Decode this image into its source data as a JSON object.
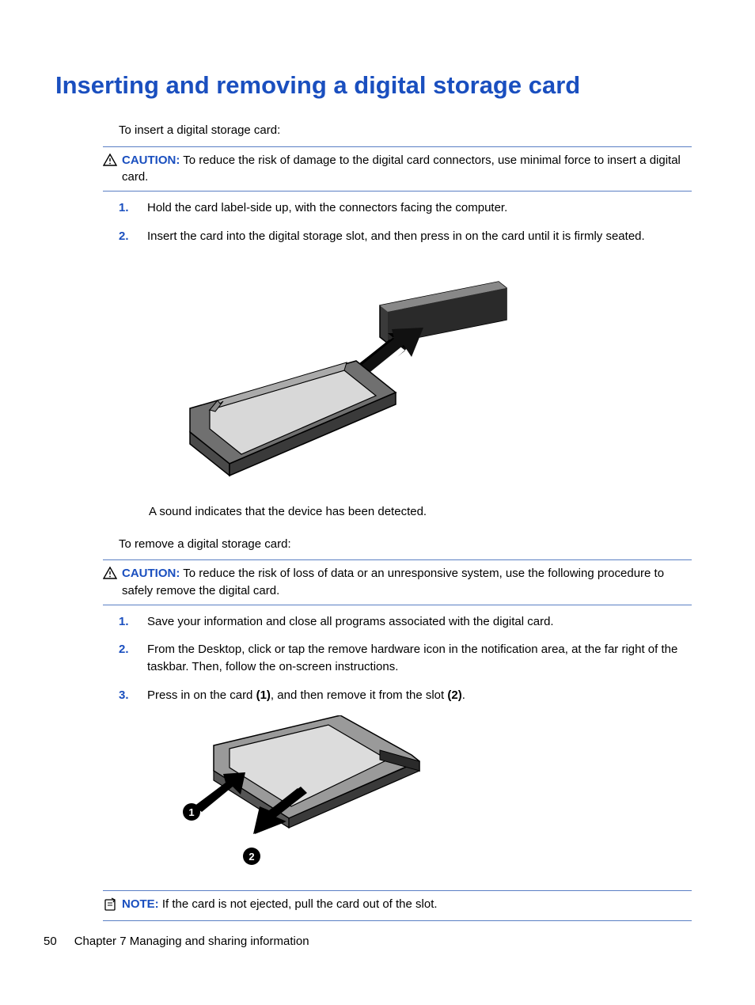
{
  "heading": "Inserting and removing a digital storage card",
  "intro_insert": "To insert a digital storage card:",
  "caution1": {
    "label": "CAUTION:",
    "text": "To reduce the risk of damage to the digital card connectors, use minimal force to insert a digital card."
  },
  "insert_steps": [
    {
      "num": "1.",
      "text": "Hold the card label-side up, with the connectors facing the computer."
    },
    {
      "num": "2.",
      "text": "Insert the card into the digital storage slot, and then press in on the card until it is firmly seated."
    }
  ],
  "sound_note": "A sound indicates that the device has been detected.",
  "intro_remove": "To remove a digital storage card:",
  "caution2": {
    "label": "CAUTION:",
    "text": "To reduce the risk of loss of data or an unresponsive system, use the following procedure to safely remove the digital card."
  },
  "remove_steps": [
    {
      "num": "1.",
      "text": "Save your information and close all programs associated with the digital card."
    },
    {
      "num": "2.",
      "text": "From the Desktop, click or tap the remove hardware icon in the notification area, at the far right of the taskbar. Then, follow the on-screen instructions."
    }
  ],
  "remove_step3": {
    "num": "3.",
    "pre": "Press in on the card ",
    "b1": "(1)",
    "mid": ", and then remove it from the slot ",
    "b2": "(2)",
    "post": "."
  },
  "note": {
    "label": "NOTE:",
    "text": "If the card is not ejected, pull the card out of the slot."
  },
  "footer": {
    "page": "50",
    "chapter": "Chapter 7   Managing and sharing information"
  }
}
